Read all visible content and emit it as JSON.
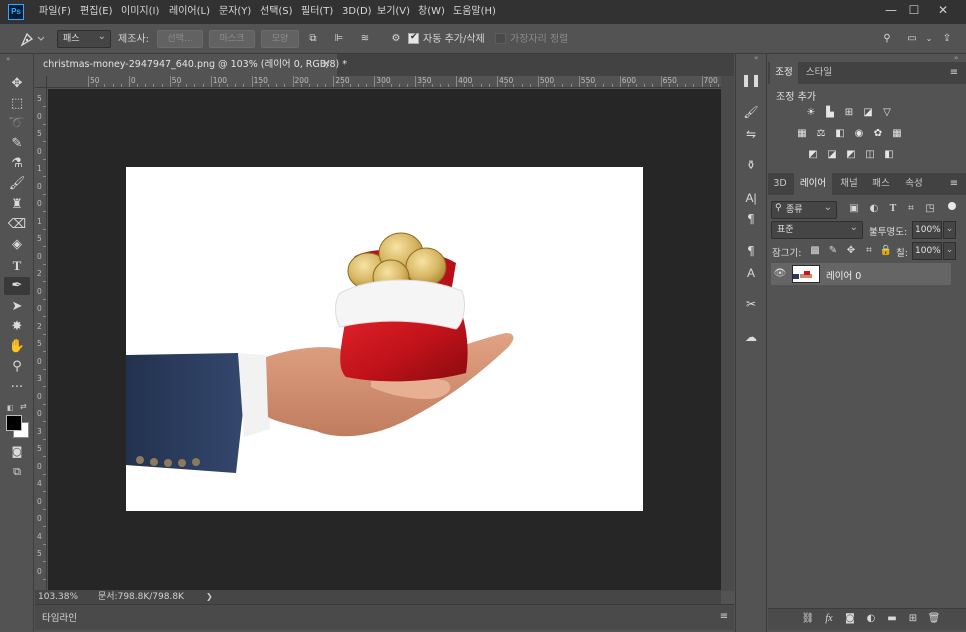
{
  "app": {
    "logo_text": "Ps",
    "menu": [
      "파일(F)",
      "편집(E)",
      "이미지(I)",
      "레이어(L)",
      "문자(Y)",
      "선택(S)",
      "필터(T)",
      "3D(D)",
      "보기(V)",
      "창(W)",
      "도움말(H)"
    ],
    "window_controls": {
      "minimize": "—",
      "maximize": "☐",
      "close": "✕"
    }
  },
  "options_bar": {
    "mode_dropdown": "패스",
    "make_label": "제조사:",
    "selection_button": "선택...",
    "mask_button": "마스크",
    "shape_button": "모양",
    "auto_add_delete": "자동 추가/삭제",
    "align_edges": "가장자리 정렬",
    "auto_add_delete_checked": true,
    "align_edges_checked": false
  },
  "document": {
    "tab_title": "christmas-money-2947947_640.png @ 103% (레이어 0, RGB/8) *",
    "ruler_h_labels": [
      "50",
      "0",
      "50",
      "100",
      "150",
      "200",
      "250",
      "300",
      "350",
      "400",
      "450",
      "500",
      "550",
      "600",
      "650",
      "700"
    ],
    "ruler_v_labels": [
      "5",
      "0",
      "5",
      "0",
      "1",
      "0",
      "0",
      "1",
      "5",
      "0",
      "2",
      "0",
      "0",
      "2",
      "5",
      "0",
      "3",
      "0",
      "0",
      "3",
      "5",
      "0",
      "4",
      "0",
      "0",
      "4",
      "5",
      "0"
    ],
    "zoom": "103.38%",
    "doc_size": "문서:798.8K/798.8K",
    "status_arrow": "❯"
  },
  "timeline": {
    "label": "타임라인"
  },
  "panels": {
    "adjustments": {
      "tabs": [
        "조정",
        "스타일"
      ],
      "add_label": "조정 추가"
    },
    "layers": {
      "tabs": [
        "3D",
        "레이어",
        "채널",
        "패스",
        "속성"
      ],
      "filter_dropdown": "종류",
      "blend_mode": "표준",
      "opacity_label": "불투명도:",
      "opacity_value": "100%",
      "lock_label": "잠그기:",
      "fill_label": "칠:",
      "fill_value": "100%",
      "layer_name": "레이어 0"
    }
  },
  "colors": {
    "accent": "#31a8ff",
    "dark": "#323232",
    "panel": "#535353",
    "pasteboard": "#262626",
    "bag_red": "#c8141c",
    "jacket_navy": "#2a3b5e",
    "coin_gold": "#d9b860"
  }
}
